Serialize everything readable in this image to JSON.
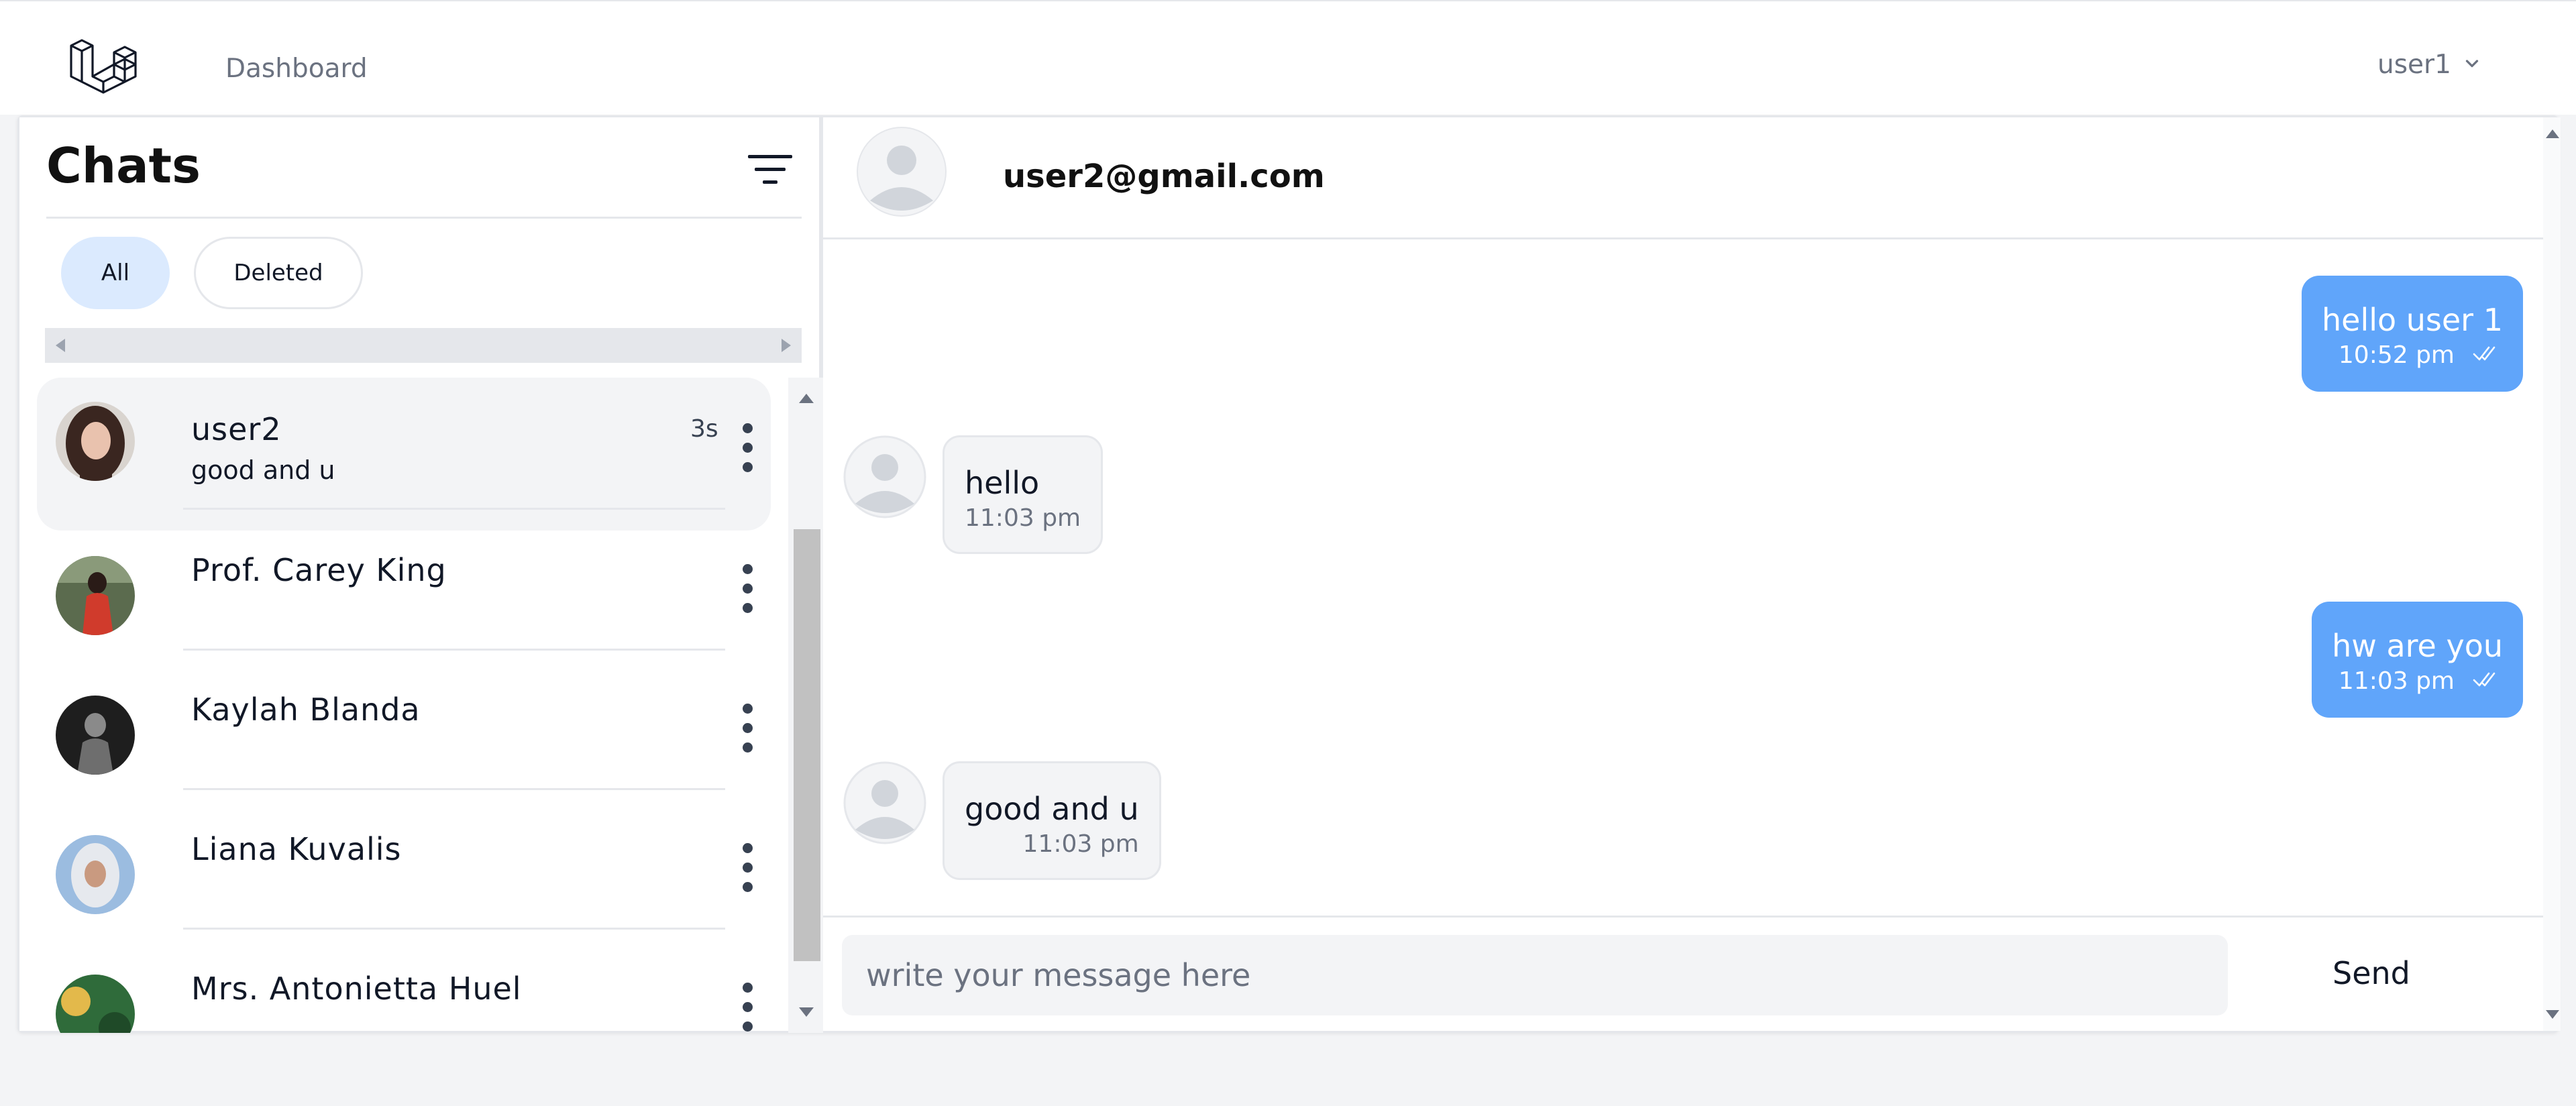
{
  "nav": {
    "logo_icon": "laravel-logo-icon",
    "dashboard_label": "Dashboard",
    "user_label": "user1",
    "user_menu_icon": "chevron-down-icon"
  },
  "chat_list": {
    "title": "Chats",
    "filter_icon": "filter-icon",
    "tabs": [
      {
        "label": "All",
        "active": true
      },
      {
        "label": "Deleted",
        "active": false
      }
    ],
    "items": [
      {
        "name": "user2",
        "preview": "good and u",
        "time": "3s",
        "active": true,
        "avatar_color": "#5a3b34"
      },
      {
        "name": "Prof. Carey King",
        "preview": "",
        "time": "",
        "active": false,
        "avatar_color": "#c0392b"
      },
      {
        "name": "Kaylah Blanda",
        "preview": "",
        "time": "",
        "active": false,
        "avatar_color": "#2b2b2b"
      },
      {
        "name": "Liana Kuvalis",
        "preview": "",
        "time": "",
        "active": false,
        "avatar_color": "#7fa6d1"
      },
      {
        "name": "Mrs. Antonietta Huel",
        "preview": "",
        "time": "",
        "active": false,
        "avatar_color": "#2f6b3a"
      }
    ]
  },
  "conversation": {
    "title": "user2@gmail.com",
    "messages": [
      {
        "direction": "out",
        "text": "hello user 1",
        "time": "10:52 pm",
        "read_icon": "double-check-icon"
      },
      {
        "direction": "in",
        "text": "hello",
        "time": "11:03 pm"
      },
      {
        "direction": "out",
        "text": "hw are you",
        "time": "11:03 pm",
        "read_icon": "double-check-icon"
      },
      {
        "direction": "in",
        "text": "good and u",
        "time": "11:03 pm"
      }
    ]
  },
  "composer": {
    "placeholder": "write your message here",
    "value": "",
    "send_label": "Send"
  },
  "colors": {
    "accent_blue": "#60a5fa",
    "pill_active": "#dbeafe",
    "bubble_in": "#f3f4f6",
    "page_bg": "#f3f4f6"
  }
}
